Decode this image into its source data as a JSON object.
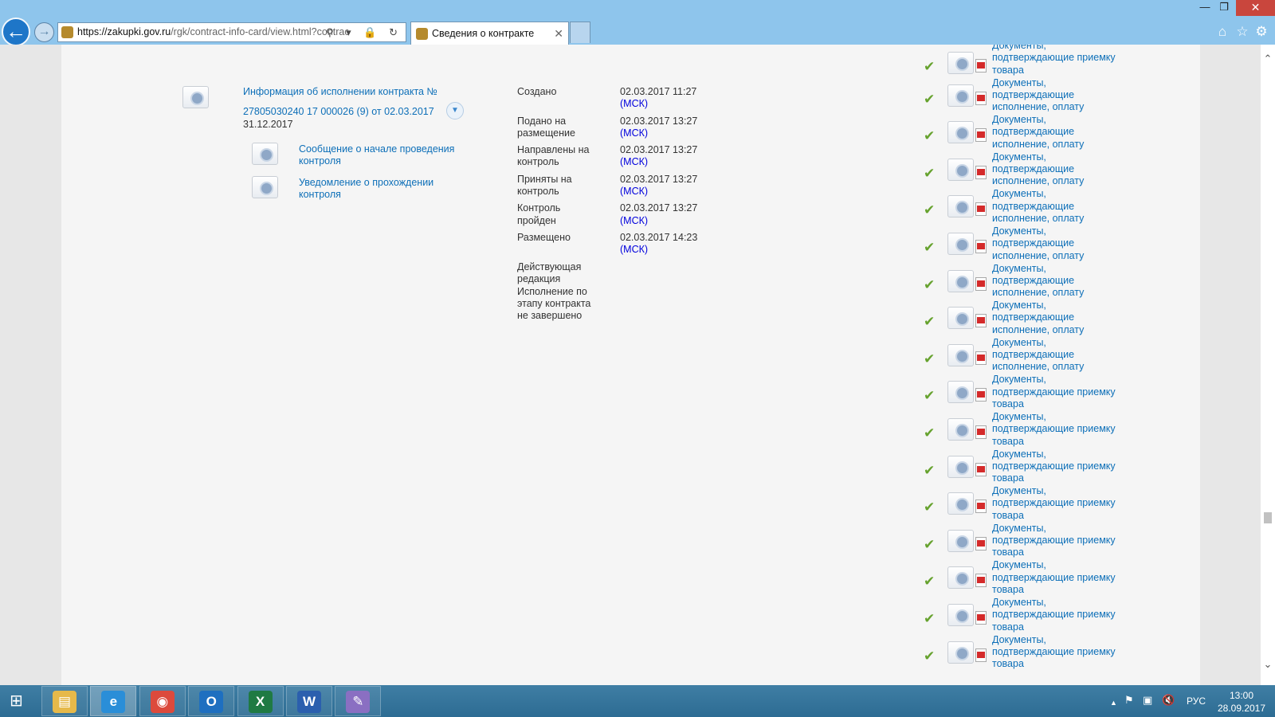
{
  "browser": {
    "url_host": "https://zakupki.gov.ru",
    "url_path": "/rgk/contract-info-card/view.html?contrac",
    "address_controls": "⚲ ▾ 🔒 ↻",
    "tab_title": "Сведения о контракте",
    "tab_close": "✕",
    "back_glyph": "←",
    "forward_glyph": "→",
    "window_buttons": {
      "minimize": "—",
      "maximize": "❐",
      "close": "✕"
    },
    "toolbar_icons": {
      "home": "⌂",
      "favorites": "☆",
      "settings": "⚙"
    }
  },
  "execution": {
    "title_line1": "Информация об исполнении контракта №",
    "title_line2": "27805030240 17 000026 (9) от 02.03.2017",
    "date": "31.12.2017",
    "expand_glyph": "▼",
    "sub_items": [
      {
        "line1": "Сообщение о начале проведения",
        "line2": "контроля"
      },
      {
        "line1": "Уведомление о прохождении",
        "line2": "контроля"
      }
    ]
  },
  "statuses": [
    {
      "l1": "Создано",
      "l2": "",
      "t": "02.03.2017 11:27",
      "z": "(МСК)"
    },
    {
      "l1": "Подано на",
      "l2": "размещение",
      "t": "02.03.2017 13:27",
      "z": "(МСК)"
    },
    {
      "l1": "Направлены на",
      "l2": "контроль",
      "t": "02.03.2017 13:27",
      "z": "(МСК)"
    },
    {
      "l1": "Приняты на",
      "l2": "контроль",
      "t": "02.03.2017 13:27",
      "z": "(МСК)"
    },
    {
      "l1": "Контроль",
      "l2": "пройден",
      "t": "02.03.2017 13:27",
      "z": "(МСК)"
    },
    {
      "l1": "Размещено",
      "l2": "",
      "t": "02.03.2017 14:23",
      "z": "(МСК)"
    }
  ],
  "current_edition": {
    "l1": "Действующая",
    "l2": "редакция",
    "l3": "Исполнение по",
    "l4": "этапу контракта",
    "l5": "не завершено"
  },
  "documents": [
    {
      "l1": "Документы,",
      "l2": "подтверждающие приемку",
      "l3": "товара"
    },
    {
      "l1": "Документы,",
      "l2": "подтверждающие",
      "l3": "исполнение, оплату"
    },
    {
      "l1": "Документы,",
      "l2": "подтверждающие",
      "l3": "исполнение, оплату"
    },
    {
      "l1": "Документы,",
      "l2": "подтверждающие",
      "l3": "исполнение, оплату"
    },
    {
      "l1": "Документы,",
      "l2": "подтверждающие",
      "l3": "исполнение, оплату"
    },
    {
      "l1": "Документы,",
      "l2": "подтверждающие",
      "l3": "исполнение, оплату"
    },
    {
      "l1": "Документы,",
      "l2": "подтверждающие",
      "l3": "исполнение, оплату"
    },
    {
      "l1": "Документы,",
      "l2": "подтверждающие",
      "l3": "исполнение, оплату"
    },
    {
      "l1": "Документы,",
      "l2": "подтверждающие",
      "l3": "исполнение, оплату"
    },
    {
      "l1": "Документы,",
      "l2": "подтверждающие приемку",
      "l3": "товара"
    },
    {
      "l1": "Документы,",
      "l2": "подтверждающие приемку",
      "l3": "товара"
    },
    {
      "l1": "Документы,",
      "l2": "подтверждающие приемку",
      "l3": "товара"
    },
    {
      "l1": "Документы,",
      "l2": "подтверждающие приемку",
      "l3": "товара"
    },
    {
      "l1": "Документы,",
      "l2": "подтверждающие приемку",
      "l3": "товара"
    },
    {
      "l1": "Документы,",
      "l2": "подтверждающие приемку",
      "l3": "товара"
    },
    {
      "l1": "Документы,",
      "l2": "подтверждающие приемку",
      "l3": "товара"
    },
    {
      "l1": "Документы,",
      "l2": "подтверждающие приемку",
      "l3": "товара"
    }
  ],
  "check_glyph": "✔",
  "scrollbar": {
    "up": "⌃",
    "down": "⌄"
  },
  "taskbar": {
    "start_glyph": "⊞",
    "apps": [
      {
        "name": "file-explorer",
        "glyph": "▤",
        "color": "#e6b94a"
      },
      {
        "name": "internet-explorer",
        "glyph": "e",
        "color": "#2a8ed8"
      },
      {
        "name": "chrome",
        "glyph": "◉",
        "color": "#dc4a3c"
      },
      {
        "name": "outlook",
        "glyph": "O",
        "color": "#1e6fc0"
      },
      {
        "name": "excel",
        "glyph": "X",
        "color": "#1f7a43"
      },
      {
        "name": "word",
        "glyph": "W",
        "color": "#2b5fae"
      },
      {
        "name": "paint",
        "glyph": "✎",
        "color": "#8a6fc2"
      }
    ],
    "tray": {
      "chevron": "▲",
      "flag": "⚑",
      "network": "▣",
      "volume": "🔇",
      "lang": "РУС",
      "time": "13:00",
      "date": "28.09.2017"
    }
  }
}
